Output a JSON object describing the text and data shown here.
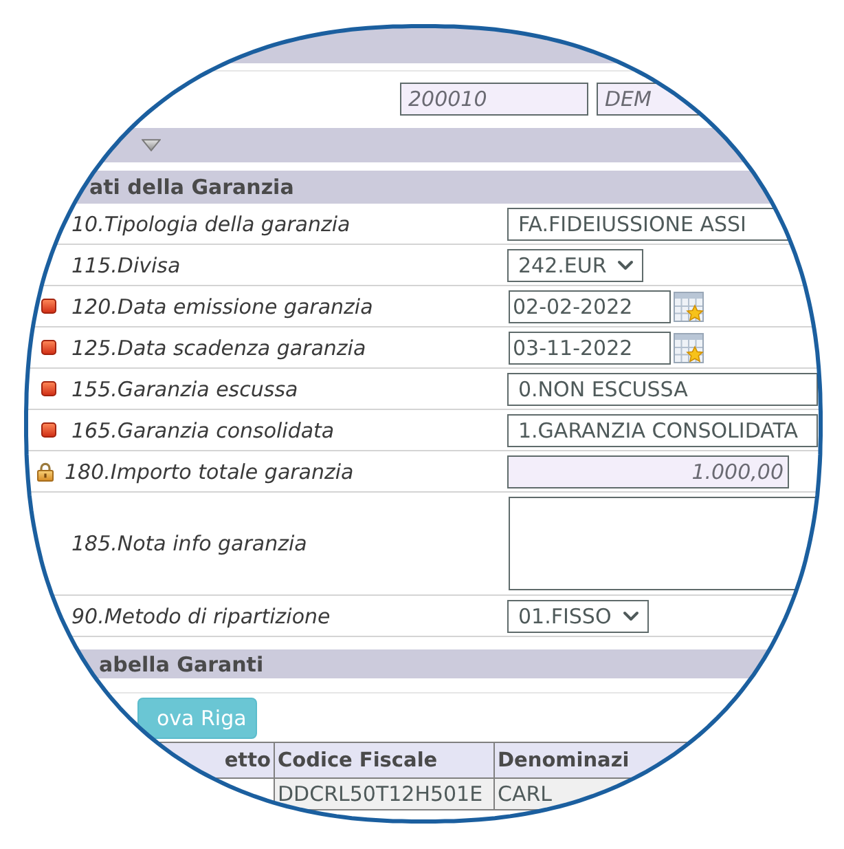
{
  "header": {
    "record_fields": [
      {
        "value": "200010",
        "readonly": true
      },
      {
        "value": "DEM",
        "readonly": true
      }
    ]
  },
  "toggle_bar": {
    "expanded": true
  },
  "guarantee_section": {
    "title": "ati della Garanzia",
    "fields": [
      {
        "kind": "text",
        "label": "10.Tipologia della garanzia",
        "value": "FA.FIDEIUSSIONE ASSI",
        "required": false,
        "locked": false
      },
      {
        "kind": "select",
        "label": "115.Divisa",
        "value": "242.EUR",
        "required": false,
        "locked": false
      },
      {
        "kind": "date",
        "label": "120.Data emissione garanzia",
        "value": "02-02-2022",
        "required": true,
        "locked": false
      },
      {
        "kind": "date",
        "label": "125.Data scadenza garanzia",
        "value": "03-11-2022",
        "required": true,
        "locked": false
      },
      {
        "kind": "text",
        "label": "155.Garanzia escussa",
        "value": "0.NON ESCUSSA",
        "required": true,
        "locked": false
      },
      {
        "kind": "text",
        "label": "165.Garanzia consolidata",
        "value": "1.GARANZIA CONSOLIDATA",
        "required": true,
        "locked": false
      },
      {
        "kind": "amount",
        "label": "180.Importo totale garanzia",
        "value": "1.000,00",
        "required": false,
        "locked": true
      },
      {
        "kind": "textarea",
        "label": "185.Nota info garanzia",
        "required": false,
        "locked": false
      },
      {
        "kind": "select",
        "label": "90.Metodo di ripartizione",
        "value": "01.FISSO",
        "required": false,
        "locked": false
      }
    ]
  },
  "guarantors_section": {
    "title": "abella Garanti",
    "add_button": "ova Riga",
    "table": {
      "columns": [
        "etto",
        "Codice Fiscale",
        "Denominazi"
      ],
      "rows": [
        {
          "cells": [
            "",
            "DDCRL50T12H501E",
            "CARL"
          ]
        }
      ]
    }
  }
}
